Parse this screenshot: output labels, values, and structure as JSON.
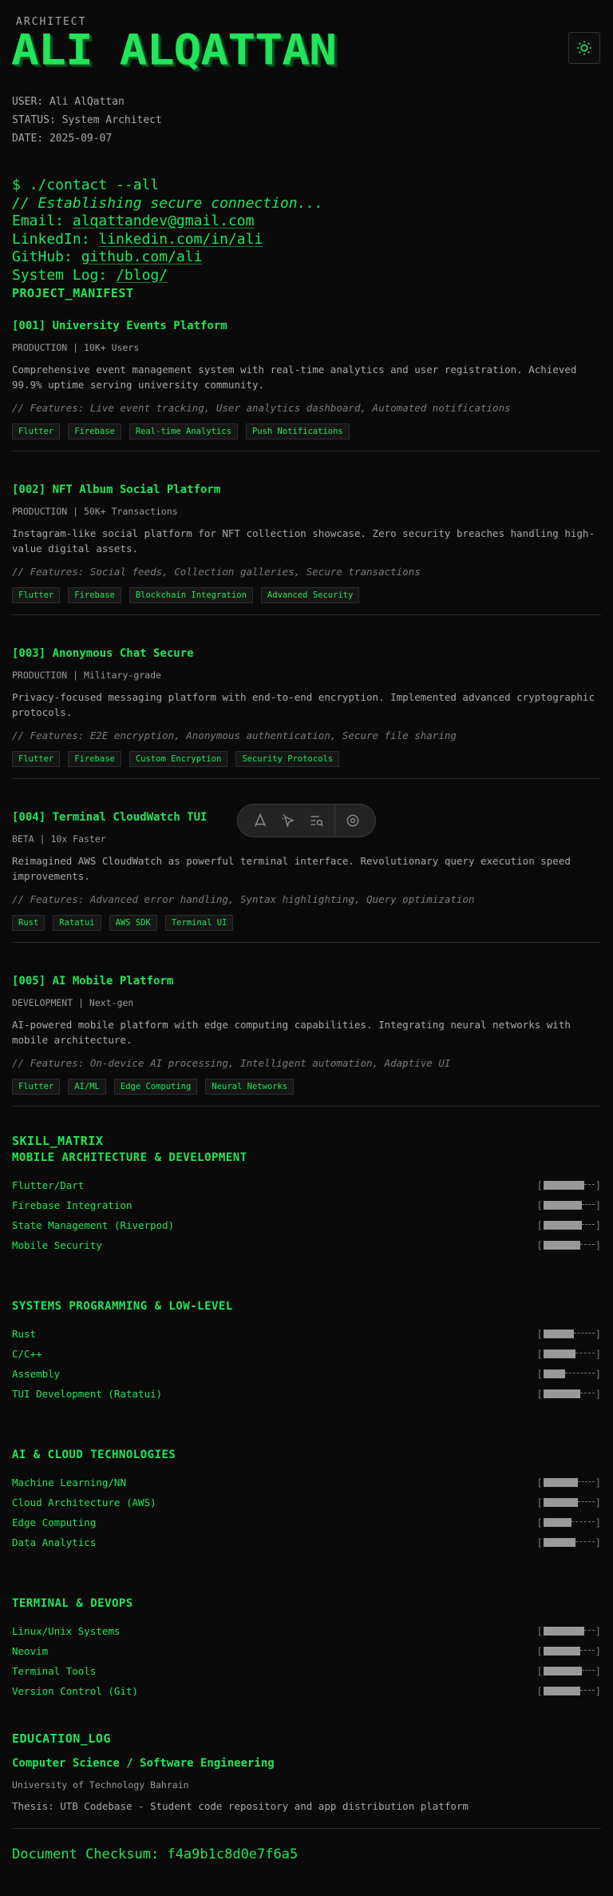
{
  "header": {
    "kicker": "ARCHITECT",
    "name": "ALI ALQATTAN",
    "theme_icon": "sun-icon"
  },
  "meta": {
    "user": "USER: Ali AlQattan",
    "status": "STATUS: System Architect",
    "date": "DATE: 2025-09-07"
  },
  "contact": {
    "command": "$ ./contact --all",
    "comment": "// Establishing secure connection...",
    "email_label": "Email:",
    "email": "alqattandev@gmail.com",
    "linkedin_label": "LinkedIn:",
    "linkedin": "linkedin.com/in/ali",
    "github_label": "GitHub:",
    "github": "github.com/ali",
    "syslog_label": "System Log:",
    "syslog": "/blog/"
  },
  "projects": {
    "title": "PROJECT_MANIFEST",
    "items": [
      {
        "title": "[001] University Events Platform",
        "sub": "PRODUCTION | 10K+ Users",
        "desc": "Comprehensive event management system with real-time analytics and user registration. Achieved 99.9% uptime serving university community.",
        "feat": "// Features: Live event tracking, User analytics dashboard, Automated notifications",
        "tags": [
          "Flutter",
          "Firebase",
          "Real-time Analytics",
          "Push Notifications"
        ]
      },
      {
        "title": "[002] NFT Album Social Platform",
        "sub": "PRODUCTION | 50K+ Transactions",
        "desc": "Instagram-like social platform for NFT collection showcase. Zero security breaches handling high-value digital assets.",
        "feat": "// Features: Social feeds, Collection galleries, Secure transactions",
        "tags": [
          "Flutter",
          "Firebase",
          "Blockchain Integration",
          "Advanced Security"
        ]
      },
      {
        "title": "[003] Anonymous Chat Secure",
        "sub": "PRODUCTION | Military-grade",
        "desc": "Privacy-focused messaging platform with end-to-end encryption. Implemented advanced cryptographic protocols.",
        "feat": "// Features: E2E encryption, Anonymous authentication, Secure file sharing",
        "tags": [
          "Flutter",
          "Firebase",
          "Custom Encryption",
          "Security Protocols"
        ]
      },
      {
        "title": "[004] Terminal CloudWatch TUI",
        "sub": "BETA | 10x Faster",
        "desc": "Reimagined AWS CloudWatch as powerful terminal interface. Revolutionary query execution speed improvements.",
        "feat": "// Features: Advanced error handling, Syntax highlighting, Query optimization",
        "tags": [
          "Rust",
          "Ratatui",
          "AWS SDK",
          "Terminal UI"
        ]
      },
      {
        "title": "[005] AI Mobile Platform",
        "sub": "DEVELOPMENT | Next-gen",
        "desc": "AI-powered mobile platform with edge computing capabilities. Integrating neural networks with mobile architecture.",
        "feat": "// Features: On-device AI processing, Intelligent automation, Adaptive UI",
        "tags": [
          "Flutter",
          "AI/ML",
          "Edge Computing",
          "Neural Networks"
        ]
      }
    ]
  },
  "skills": {
    "title": "SKILL_MATRIX",
    "groups": [
      {
        "name": "MOBILE ARCHITECTURE & DEVELOPMENT",
        "items": [
          {
            "name": "Flutter/Dart",
            "level": 0.95
          },
          {
            "name": "Firebase Integration",
            "level": 0.9
          },
          {
            "name": "State Management (Riverpod)",
            "level": 0.9
          },
          {
            "name": "Mobile Security",
            "level": 0.85
          }
        ]
      },
      {
        "name": "SYSTEMS PROGRAMMING & LOW-LEVEL",
        "items": [
          {
            "name": "Rust",
            "level": 0.7
          },
          {
            "name": "C/C++",
            "level": 0.75
          },
          {
            "name": "Assembly",
            "level": 0.5
          },
          {
            "name": "TUI Development (Ratatui)",
            "level": 0.85
          }
        ]
      },
      {
        "name": "AI & CLOUD TECHNOLOGIES",
        "items": [
          {
            "name": "Machine Learning/NN",
            "level": 0.8
          },
          {
            "name": "Cloud Architecture (AWS)",
            "level": 0.8
          },
          {
            "name": "Edge Computing",
            "level": 0.65
          },
          {
            "name": "Data Analytics",
            "level": 0.75
          }
        ]
      },
      {
        "name": "TERMINAL & DEVOPS",
        "items": [
          {
            "name": "Linux/Unix Systems",
            "level": 0.95
          },
          {
            "name": "Neovim",
            "level": 0.85
          },
          {
            "name": "Terminal Tools",
            "level": 0.9
          },
          {
            "name": "Version Control (Git)",
            "level": 0.85
          }
        ]
      }
    ]
  },
  "education": {
    "title": "EDUCATION_LOG",
    "degree": "Computer Science / Software Engineering",
    "school": "University of Technology Bahrain",
    "thesis": "Thesis: UTB Codebase - Student code repository and app distribution platform"
  },
  "checksum": "Document Checksum: f4a9b1c8d0e7f6a5",
  "toolbar": {
    "icons": [
      "astro-icon",
      "inspect-icon",
      "audit-icon",
      "settings-icon"
    ]
  }
}
